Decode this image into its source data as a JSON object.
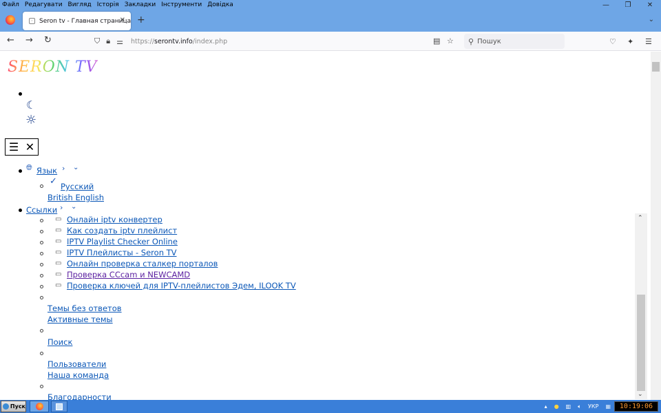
{
  "menubar": {
    "items": [
      "Файл",
      "Редагувати",
      "Вигляд",
      "Історія",
      "Закладки",
      "Інструменти",
      "Довідка"
    ],
    "minimize_glyph": "—",
    "maximize_glyph": "❐",
    "close_glyph": "✕"
  },
  "tabs": {
    "active": {
      "title": "Seron tv - Главная страница",
      "close_glyph": "✕"
    },
    "new_tab_glyph": "+",
    "list_glyph": "⌄"
  },
  "navbar": {
    "back_glyph": "←",
    "forward_glyph": "→",
    "reload_glyph": "↻",
    "url_prefix": "https://",
    "url_host": "serontv.info",
    "url_path": "/index.php",
    "search_placeholder": "Пошук"
  },
  "page": {
    "logo_text": "SERON TV",
    "theme_dark_glyph": "☾",
    "theme_light_glyph": "☼",
    "menu_open_glyph": "☰",
    "menu_close_glyph": "✕",
    "language": {
      "label": "Язык",
      "options": [
        {
          "label": "Русский",
          "checked": true
        },
        {
          "label": "British English",
          "checked": false
        }
      ]
    },
    "links": {
      "label": "Ссылки",
      "items": [
        "Онлайн iptv конвертер",
        "Как создать iptv плейлист",
        "IPTV Playlist Checker Online",
        "IPTV Плейлисты - Seron TV",
        "Онлайн проверка сталкер порталов",
        "Проверка CCcam и NEWCAMD",
        "Проверка ключей для IPTV-плейлистов Эдем, ILOOK TV"
      ]
    },
    "nav_links": {
      "unanswered": "Темы без ответов",
      "active": "Активные темы",
      "search": "Поиск",
      "users": "Пользователи",
      "team": "Наша команда",
      "thanks": "Благодарности"
    }
  },
  "taskbar": {
    "start_label": "Пуск",
    "language": "УКР",
    "clock": "10:19:06"
  },
  "colors": {
    "chrome_blue": "#6ea6e6",
    "link": "#0b57b7",
    "visited_link": "#5a1fa0",
    "taskbar": "#3a7fd9"
  }
}
